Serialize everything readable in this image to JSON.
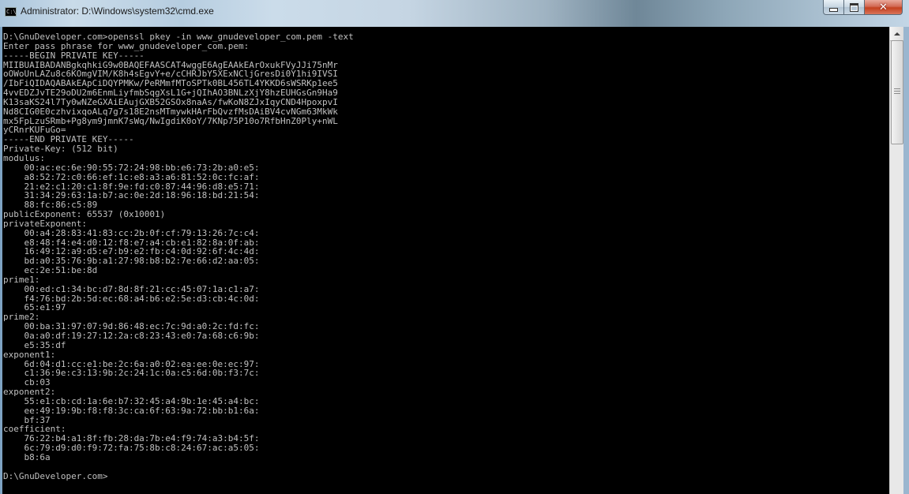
{
  "window": {
    "title": "Administrator: D:\\Windows\\system32\\cmd.exe",
    "app_icon_text": "C:\\"
  },
  "caption": {
    "minimize_icon": "minimize-icon",
    "maximize_icon": "maximize-icon",
    "close_glyph": "✕"
  },
  "console": {
    "lines": [
      "D:\\GnuDeveloper.com>openssl pkey -in www_gnudeveloper_com.pem -text",
      "Enter pass phrase for www_gnudeveloper_com.pem:",
      "-----BEGIN PRIVATE KEY-----",
      "MIIBUAIBADANBgkqhkiG9w0BAQEFAASCAT4wggE6AgEAAkEArOxukFVyJJi75nMr",
      "oOWoUnLAZu8c6KOmgVIM/K8h4sEgvY+e/cCHRJbY5XExNCljGresDi0Y1hi9IVSI",
      "/IbFiQIDAQABAkEApCiDQYPMKw/PeRMmfMToSPTk0BL456TL4YKKD6sWSRKp1ee5",
      "4vvEDZJvTE29oDU2m6EnmLiyfmbSqgXsL1G+jQIhAO3BNLzXjY8hzEUHGsGn9Ha9",
      "K13saKS24l7Ty0wNZeGXAiEAujGXB52GSOx8naAs/fwKoN8ZJxIqyCND4HpoxpvI",
      "Nd8CIG0E0czhvixqoALq7g7s18E2nsMTmywkHArFbQvzfMsDAiBV4cvNGm63MkWk",
      "mx5FpLzuSRmb+Pg8ym9jmnK7sWq/NwIgdiK0oY/7KNp75P10o7RfbHnZ0Ply+nWL",
      "yCRnrKUFuGo=",
      "-----END PRIVATE KEY-----",
      "Private-Key: (512 bit)",
      "modulus:",
      "    00:ac:ec:6e:90:55:72:24:98:bb:e6:73:2b:a0:e5:",
      "    a8:52:72:c0:66:ef:1c:e8:a3:a6:81:52:0c:fc:af:",
      "    21:e2:c1:20:c1:8f:9e:fd:c0:87:44:96:d8:e5:71:",
      "    31:34:29:63:1a:b7:ac:0e:2d:18:96:18:bd:21:54:",
      "    88:fc:86:c5:89",
      "publicExponent: 65537 (0x10001)",
      "privateExponent:",
      "    00:a4:28:83:41:83:cc:2b:0f:cf:79:13:26:7c:c4:",
      "    e8:48:f4:e4:d0:12:f8:e7:a4:cb:e1:82:8a:0f:ab:",
      "    16:49:12:a9:d5:e7:b9:e2:fb:c4:0d:92:6f:4c:4d:",
      "    bd:a0:35:76:9b:a1:27:98:b8:b2:7e:66:d2:aa:05:",
      "    ec:2e:51:be:8d",
      "prime1:",
      "    00:ed:c1:34:bc:d7:8d:8f:21:cc:45:07:1a:c1:a7:",
      "    f4:76:bd:2b:5d:ec:68:a4:b6:e2:5e:d3:cb:4c:0d:",
      "    65:e1:97",
      "prime2:",
      "    00:ba:31:97:07:9d:86:48:ec:7c:9d:a0:2c:fd:fc:",
      "    0a:a0:df:19:27:12:2a:c8:23:43:e0:7a:68:c6:9b:",
      "    e5:35:df",
      "exponent1:",
      "    6d:04:d1:cc:e1:be:2c:6a:a0:02:ea:ee:0e:ec:97:",
      "    c1:36:9e:c3:13:9b:2c:24:1c:0a:c5:6d:0b:f3:7c:",
      "    cb:03",
      "exponent2:",
      "    55:e1:cb:cd:1a:6e:b7:32:45:a4:9b:1e:45:a4:bc:",
      "    ee:49:19:9b:f8:f8:3c:ca:6f:63:9a:72:bb:b1:6a:",
      "    bf:37",
      "coefficient:",
      "    76:22:b4:a1:8f:fb:28:da:7b:e4:f9:74:a3:b4:5f:",
      "    6c:79:d9:d0:f9:72:fa:75:8b:c8:24:67:ac:a5:05:",
      "    b8:6a",
      "",
      "D:\\GnuDeveloper.com>"
    ]
  }
}
